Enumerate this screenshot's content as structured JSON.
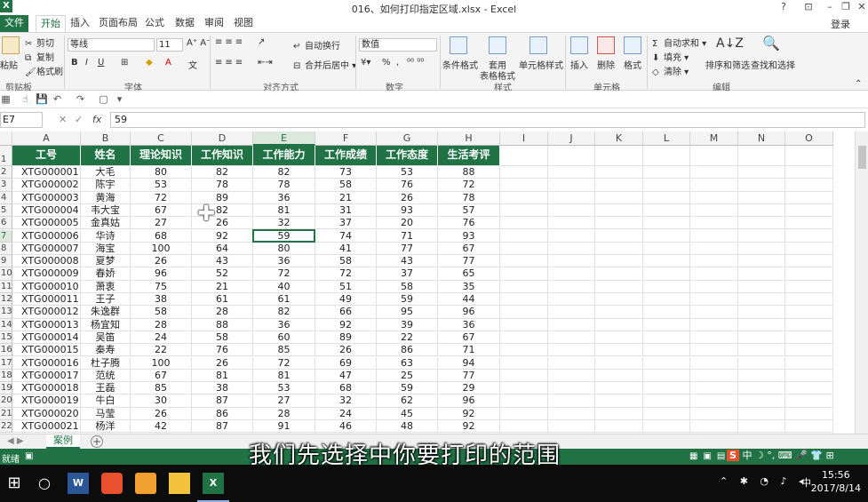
{
  "window": {
    "title": "016、如何打印指定区域.xlsx - Excel",
    "help": "?",
    "minimize": "–",
    "restore": "❐",
    "close": "✕",
    "login": "登录"
  },
  "tabs": [
    "文件",
    "开始",
    "插入",
    "页面布局",
    "公式",
    "数据",
    "审阅",
    "视图"
  ],
  "ribbon": {
    "clipboard": {
      "paste": "粘贴",
      "cut": "剪切",
      "copy": "复制",
      "format_painter": "格式刷",
      "label": "剪贴板"
    },
    "font": {
      "name": "等线",
      "size": "11",
      "bold": "B",
      "italic": "I",
      "underline": "U",
      "label": "字体"
    },
    "alignment": {
      "wrap": "自动换行",
      "merge": "合并后居中",
      "label": "对齐方式"
    },
    "number": {
      "format": "数值",
      "percent": "%",
      "comma": ",",
      "label": "数字"
    },
    "styles": {
      "conditional": "条件格式",
      "table": "套用",
      "table2": "表格格式",
      "cell_styles": "单元格样式",
      "label": "样式"
    },
    "cells": {
      "insert": "插入",
      "delete": "删除",
      "format": "格式",
      "label": "单元格"
    },
    "editing": {
      "autosum": "自动求和",
      "fill": "填充",
      "clear": "清除",
      "sort": "排序和筛选",
      "find": "查找和选择",
      "label": "编辑"
    }
  },
  "formula_bar": {
    "name_box": "E7",
    "fx": "fx",
    "value": "59"
  },
  "columns": [
    "A",
    "B",
    "C",
    "D",
    "E",
    "F",
    "G",
    "H",
    "I",
    "J",
    "K",
    "L",
    "M",
    "N",
    "O"
  ],
  "selected_column": "E",
  "headers": [
    "工号",
    "姓名",
    "理论知识",
    "工作知识",
    "工作能力",
    "工作成绩",
    "工作态度",
    "生活考评"
  ],
  "rows": [
    [
      "XTG000001",
      "大毛",
      "80",
      "82",
      "82",
      "73",
      "53",
      "88"
    ],
    [
      "XTG000002",
      "陈宇",
      "53",
      "78",
      "78",
      "58",
      "76",
      "72"
    ],
    [
      "XTG000003",
      "黄海",
      "72",
      "89",
      "36",
      "21",
      "26",
      "78"
    ],
    [
      "XTG000004",
      "韦大宝",
      "67",
      "82",
      "81",
      "31",
      "93",
      "57"
    ],
    [
      "XTG000005",
      "金真姑",
      "27",
      "26",
      "32",
      "37",
      "20",
      "76"
    ],
    [
      "XTG000006",
      "华诗",
      "68",
      "92",
      "59",
      "74",
      "71",
      "93"
    ],
    [
      "XTG000007",
      "海宝",
      "100",
      "64",
      "80",
      "41",
      "77",
      "67"
    ],
    [
      "XTG000008",
      "夏梦",
      "26",
      "43",
      "36",
      "58",
      "43",
      "77"
    ],
    [
      "XTG000009",
      "春娇",
      "96",
      "52",
      "72",
      "72",
      "37",
      "65"
    ],
    [
      "XTG000010",
      "萧衷",
      "75",
      "21",
      "40",
      "51",
      "58",
      "35"
    ],
    [
      "XTG000011",
      "王子",
      "38",
      "61",
      "61",
      "49",
      "59",
      "44"
    ],
    [
      "XTG000012",
      "朱逸群",
      "58",
      "28",
      "82",
      "66",
      "95",
      "96"
    ],
    [
      "XTG000013",
      "杨宜知",
      "28",
      "88",
      "36",
      "92",
      "39",
      "36"
    ],
    [
      "XTG000014",
      "吴笛",
      "24",
      "58",
      "60",
      "89",
      "22",
      "67"
    ],
    [
      "XTG000015",
      "秦寿",
      "22",
      "76",
      "85",
      "26",
      "86",
      "71"
    ],
    [
      "XTG000016",
      "杜子腾",
      "100",
      "26",
      "72",
      "69",
      "63",
      "94"
    ],
    [
      "XTG000017",
      "范统",
      "67",
      "81",
      "81",
      "47",
      "25",
      "77"
    ],
    [
      "XTG000018",
      "王磊",
      "85",
      "38",
      "53",
      "68",
      "59",
      "29"
    ],
    [
      "XTG000019",
      "牛白",
      "30",
      "87",
      "27",
      "32",
      "62",
      "96"
    ],
    [
      "XTG000020",
      "马莹",
      "26",
      "86",
      "28",
      "24",
      "45",
      "92"
    ],
    [
      "XTG000021",
      "杨洋",
      "42",
      "87",
      "91",
      "46",
      "48",
      "92"
    ]
  ],
  "row_numbers": [
    "1",
    "2",
    "3",
    "4",
    "5",
    "6",
    "7",
    "8",
    "9",
    "10",
    "11",
    "12",
    "13",
    "14",
    "15",
    "16",
    "17",
    "18",
    "19",
    "20",
    "21",
    "22"
  ],
  "sheet": {
    "tab": "案例",
    "add": "+"
  },
  "status": {
    "text": "就绪"
  },
  "subtitle": "我们先选择中你要打印的范围",
  "ime": "中",
  "clock": {
    "time": "15:56",
    "date": "2017/8/14"
  },
  "tray": {
    "lang": "中"
  }
}
